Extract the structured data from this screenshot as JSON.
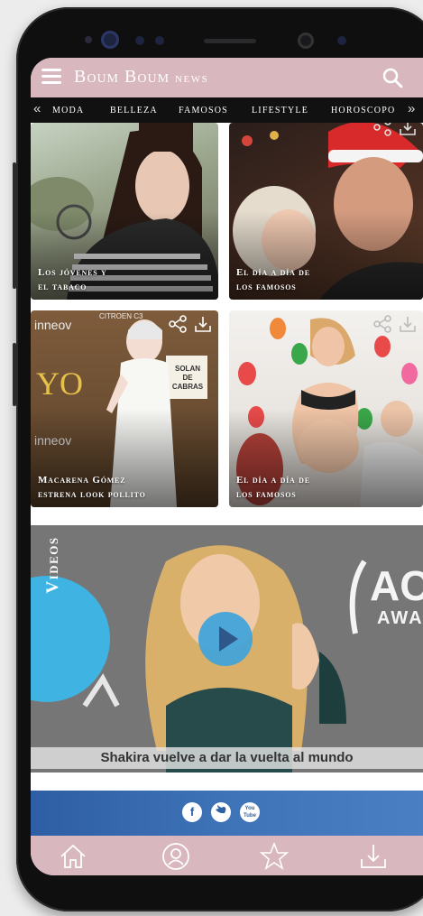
{
  "app": {
    "brand_main": "Boum Boum",
    "brand_sub": "news"
  },
  "categories": {
    "items": [
      "Moda",
      "Belleza",
      "Famosos",
      "Lifestyle",
      "Horoscopo"
    ]
  },
  "cards": [
    {
      "caption_line1": "Los jóvenes y",
      "caption_line2": "el tabaco"
    },
    {
      "caption_line1": "El día a día de",
      "caption_line2": "los famosos"
    },
    {
      "caption_line1": "Macarena Gómez",
      "caption_line2": "estrena look pollito",
      "bg_text_1": "inneov",
      "bg_text_2": "CITROEN C3",
      "bg_text_3": "YO",
      "bg_text_4": "SOLAN DE CABRAS",
      "bg_text_5": "inneov"
    },
    {
      "caption_line1": "El día a día de",
      "caption_line2": "los famosos"
    }
  ],
  "video": {
    "badge_label": "Videos",
    "caption": "Shakira vuelve a dar la vuelta al mundo",
    "bg_text_right": "AC",
    "bg_text_right2": "AWA"
  },
  "social": {
    "icons": [
      "facebook-icon",
      "twitter-icon",
      "youtube-icon"
    ],
    "facebook_glyph": "f",
    "youtube_label": "You Tube"
  },
  "bottom_nav": {
    "icons": [
      "home-icon",
      "profile-icon",
      "star-icon",
      "download-icon"
    ]
  },
  "colors": {
    "header_pink": "#d9b7bf",
    "category_bar": "#111111",
    "video_badge": "#3fb4e3",
    "play_button": "#3fa3db",
    "social_bar": "#3e73b8"
  }
}
